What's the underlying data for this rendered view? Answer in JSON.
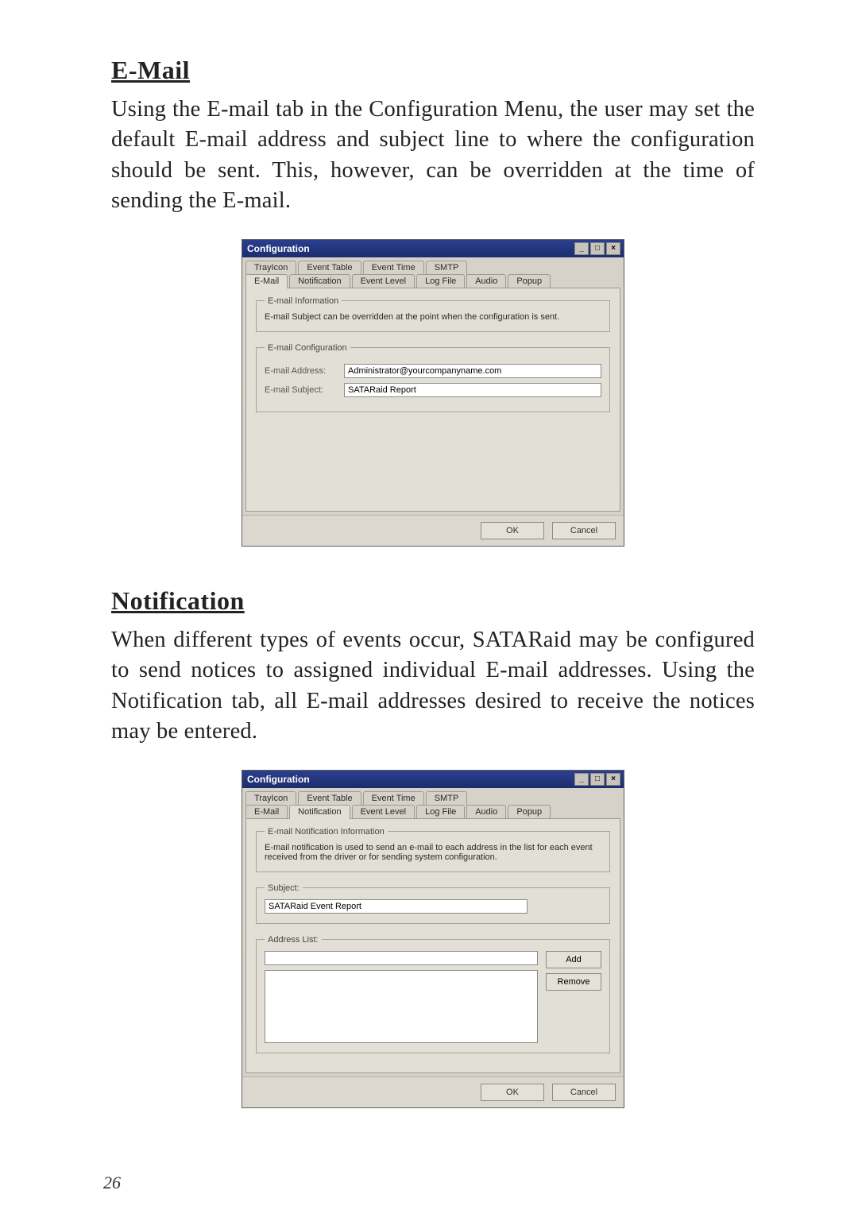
{
  "page_number": "26",
  "section_email": {
    "heading": "E-Mail",
    "paragraph": "Using the E-mail tab in the Configuration Menu, the user may set the default E-mail address and subject line to where the configuration should be sent. This, however, can be overridden at the time of sending the E-mail."
  },
  "dialog_email": {
    "title": "Configuration",
    "tabs_row1": [
      "TrayIcon",
      "Event Table",
      "Event Time",
      "SMTP"
    ],
    "tabs_row2": [
      "E-Mail",
      "Notification",
      "Event Level",
      "Log File",
      "Audio",
      "Popup"
    ],
    "active_tab": "E-Mail",
    "info_legend": "E-mail Information",
    "info_text": "E-mail Subject can be overridden at the point when the configuration is sent.",
    "config_legend": "E-mail Configuration",
    "address_label": "E-mail Address:",
    "address_value": "Administrator@yourcompanyname.com",
    "subject_label": "E-mail Subject:",
    "subject_value": "SATARaid Report",
    "ok": "OK",
    "cancel": "Cancel"
  },
  "section_notification": {
    "heading": "Notification",
    "paragraph": "When different types of events occur, SATARaid may be configured to send notices to assigned individual E-mail addresses. Using the Notification tab, all E-mail addresses desired to receive the notices may be entered."
  },
  "dialog_notification": {
    "title": "Configuration",
    "tabs_row1": [
      "TrayIcon",
      "Event Table",
      "Event Time",
      "SMTP"
    ],
    "tabs_row2": [
      "E-Mail",
      "Notification",
      "Event Level",
      "Log File",
      "Audio",
      "Popup"
    ],
    "active_tab": "Notification",
    "info_legend": "E-mail Notification Information",
    "info_text": "E-mail notification is used to send an e-mail to each address in the list for each event received from the driver or for sending system configuration.",
    "subject_legend": "Subject:",
    "subject_value": "SATARaid Event Report",
    "addrlist_legend": "Address List:",
    "add": "Add",
    "remove": "Remove",
    "ok": "OK",
    "cancel": "Cancel"
  }
}
